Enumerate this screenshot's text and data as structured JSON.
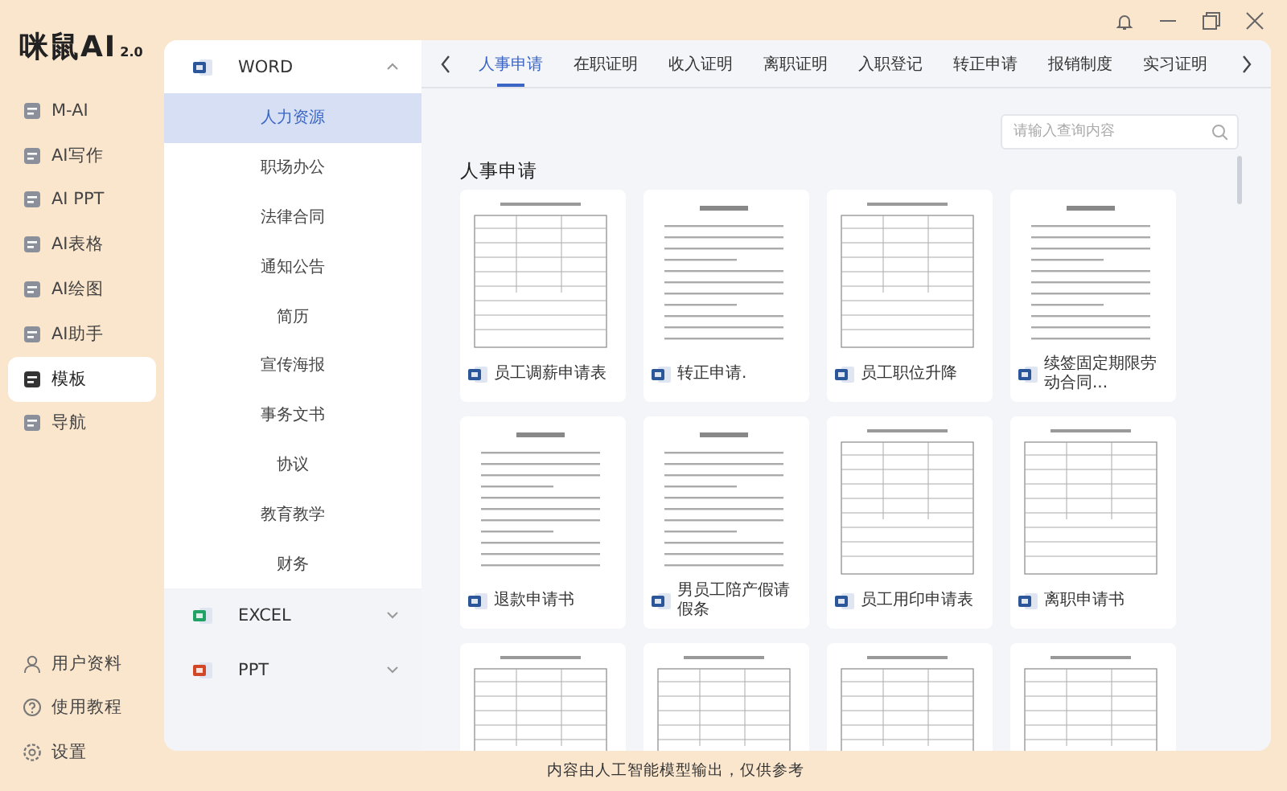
{
  "app": {
    "logo": "咪鼠AI",
    "version": "2.0"
  },
  "nav": {
    "items": [
      {
        "label": "M-AI",
        "selected": false
      },
      {
        "label": "AI写作",
        "selected": false
      },
      {
        "label": "AI PPT",
        "selected": false
      },
      {
        "label": "AI表格",
        "selected": false
      },
      {
        "label": "AI绘图",
        "selected": false
      },
      {
        "label": "AI助手",
        "selected": false
      },
      {
        "label": "模板",
        "selected": true
      },
      {
        "label": "导航",
        "selected": false
      }
    ],
    "bottom_items": [
      {
        "label": "用户资料",
        "kind": "user"
      },
      {
        "label": "使用教程",
        "kind": "help"
      },
      {
        "label": "设置",
        "kind": "settings"
      }
    ]
  },
  "categories": [
    {
      "label": "WORD",
      "kind": "word",
      "expanded": true,
      "children": [
        {
          "label": "人力资源",
          "selected": true
        },
        {
          "label": "职场办公",
          "selected": false
        },
        {
          "label": "法律合同",
          "selected": false
        },
        {
          "label": "通知公告",
          "selected": false
        },
        {
          "label": "简历",
          "selected": false
        },
        {
          "label": "宣传海报",
          "selected": false
        },
        {
          "label": "事务文书",
          "selected": false
        },
        {
          "label": "协议",
          "selected": false
        },
        {
          "label": "教育教学",
          "selected": false
        },
        {
          "label": "财务",
          "selected": false
        }
      ]
    },
    {
      "label": "EXCEL",
      "kind": "excel",
      "expanded": false
    },
    {
      "label": "PPT",
      "kind": "ppt",
      "expanded": false
    }
  ],
  "tabs": [
    {
      "label": "人事申请",
      "selected": true
    },
    {
      "label": "在职证明",
      "selected": false
    },
    {
      "label": "收入证明",
      "selected": false
    },
    {
      "label": "离职证明",
      "selected": false
    },
    {
      "label": "入职登记",
      "selected": false
    },
    {
      "label": "转正申请",
      "selected": false
    },
    {
      "label": "报销制度",
      "selected": false
    },
    {
      "label": "实习证明",
      "selected": false
    }
  ],
  "search": {
    "placeholder": "请输入查询内容"
  },
  "section_title": "人事申请",
  "templates": [
    {
      "title": "员工调薪申请表",
      "kind": "form"
    },
    {
      "title": "转正申请.",
      "kind": "letter"
    },
    {
      "title": "员工职位升降",
      "kind": "form"
    },
    {
      "title": "续签固定期限劳动合同...",
      "kind": "letter"
    },
    {
      "title": "退款申请书",
      "kind": "letter"
    },
    {
      "title": "男员工陪产假请假条",
      "kind": "letter"
    },
    {
      "title": "员工用印申请表",
      "kind": "form"
    },
    {
      "title": "离职申请书",
      "kind": "form"
    },
    {
      "kind": "form"
    },
    {
      "kind": "form"
    },
    {
      "kind": "form"
    },
    {
      "kind": "form"
    }
  ],
  "footer": "内容由人工智能模型输出，仅供参考"
}
